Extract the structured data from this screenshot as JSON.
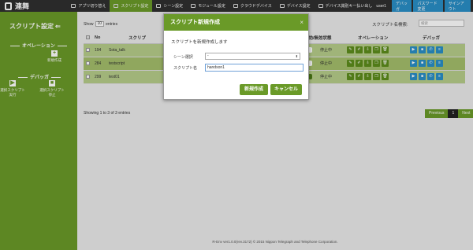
{
  "app": {
    "title": "連舞"
  },
  "nav": {
    "items": [
      {
        "label": "アプリ切り替え",
        "icon": "grid-icon"
      },
      {
        "label": "スクリプト設定",
        "icon": "script-icon",
        "active": true
      },
      {
        "label": "シーン設定",
        "icon": "scene-icon"
      },
      {
        "label": "モジュール設定",
        "icon": "module-icon"
      },
      {
        "label": "クラウドデバイス",
        "icon": "cloud-icon"
      },
      {
        "label": "デバイス設定",
        "icon": "device-icon"
      },
      {
        "label": "デバイス識別キー払い出し",
        "icon": "key-icon"
      }
    ],
    "user": "user1",
    "debugger": "デバッガ",
    "password": "パスワード変更",
    "signout": "サインアウト"
  },
  "sidebar": {
    "title": "スクリプト設定",
    "arrow": "⇐",
    "operation_header": "オペレーション",
    "new_label": "新規作成",
    "debugger_header": "デバッガ",
    "run_label": "選択スクリプト実行",
    "stop_label": "選択スクリプト停止"
  },
  "table": {
    "show": "Show",
    "entries_value": "10",
    "entries": "entries",
    "search_label": "スクリプト名検索:",
    "search_placeholder": "検索",
    "headers": {
      "no": "No",
      "script": "スクリプ",
      "enabled": "有効/無効状態",
      "status": "ステータス",
      "operation": "オペレーション",
      "debugger": "デバッガ"
    },
    "rows": [
      {
        "no": "194",
        "name": "Sota_talk",
        "status": "停止中"
      },
      {
        "no": "284",
        "name": "testscript",
        "status": "停止中"
      },
      {
        "no": "299",
        "name": "test01",
        "status": "停止中"
      }
    ],
    "showing": "Showing 1 to 3 of 3 entries",
    "pager": {
      "prev": "Previous",
      "current": "1",
      "next": "Next"
    }
  },
  "footer": "R-Env ver1.0.0(rev.3172)  © 2015 Nippon Telegraph and Telephone Corporation.",
  "modal": {
    "title": "スクリプト新規作成",
    "close": "×",
    "description": "スクリプトを新規作成します",
    "scene_label": "シーン選択",
    "scene_value": "-",
    "name_label": "スクリプト名",
    "name_value": "handson1",
    "create": "新規作成",
    "cancel": "キャンセル"
  },
  "colors": {
    "green": "#6a9a28",
    "blue": "#2a8fc7",
    "dark": "#2f2f2f"
  }
}
